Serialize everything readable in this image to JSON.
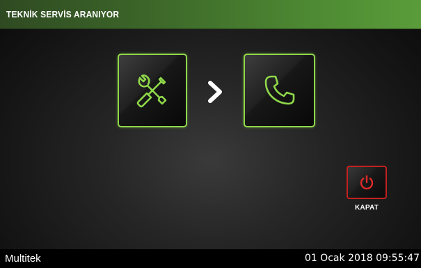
{
  "header": {
    "title": "TEKNİK SERVİS ARANIYOR"
  },
  "flow": {
    "source_icon": "tools-icon",
    "separator_icon": "chevron-right-icon",
    "target_icon": "phone-icon",
    "accent_color": "#8fd84a"
  },
  "actions": {
    "close_label": "KAPAT",
    "close_icon": "power-icon",
    "close_color": "#c42020"
  },
  "status_bar": {
    "brand": "Multitek",
    "datetime": "01 Ocak 2018 09:55:47"
  }
}
